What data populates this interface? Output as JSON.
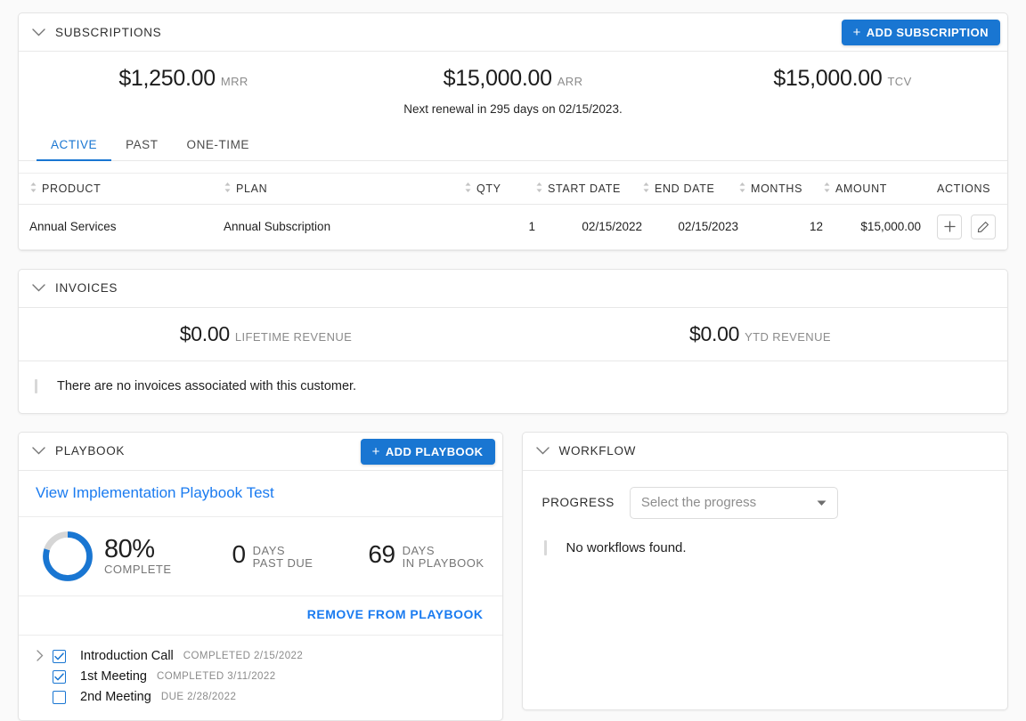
{
  "subscriptions": {
    "title": "SUBSCRIPTIONS",
    "add_button": "ADD SUBSCRIPTION",
    "add_button_plus": "+",
    "metrics": [
      {
        "value": "$1,250.00",
        "label": "MRR"
      },
      {
        "value": "$15,000.00",
        "label": "ARR"
      },
      {
        "value": "$15,000.00",
        "label": "TCV"
      }
    ],
    "renewal_note": "Next renewal in 295 days on 02/15/2023.",
    "tabs": [
      {
        "label": "ACTIVE",
        "active": true
      },
      {
        "label": "PAST",
        "active": false
      },
      {
        "label": "ONE-TIME",
        "active": false
      }
    ],
    "columns": [
      "PRODUCT",
      "PLAN",
      "QTY",
      "START DATE",
      "END DATE",
      "MONTHS",
      "AMOUNT",
      "ACTIONS"
    ],
    "rows": [
      {
        "product": "Annual Services",
        "plan": "Annual Subscription",
        "qty": "1",
        "start_date": "02/15/2022",
        "end_date": "02/15/2023",
        "months": "12",
        "amount": "$15,000.00"
      }
    ]
  },
  "invoices": {
    "title": "INVOICES",
    "metrics": [
      {
        "value": "$0.00",
        "label": "LIFETIME REVENUE"
      },
      {
        "value": "$0.00",
        "label": "YTD REVENUE"
      }
    ],
    "empty_message": "There are no invoices associated with this customer."
  },
  "playbook": {
    "title": "PLAYBOOK",
    "add_button": "ADD PLAYBOOK",
    "add_button_plus": "+",
    "link": "View Implementation Playbook Test",
    "progress": {
      "percent_value": "80%",
      "percent_label": "COMPLETE",
      "percent_number": 80
    },
    "stats": [
      {
        "number": "0",
        "line1": "DAYS",
        "line2": "PAST DUE"
      },
      {
        "number": "69",
        "line1": "DAYS",
        "line2": "IN PLAYBOOK"
      }
    ],
    "remove_button": "REMOVE FROM PLAYBOOK",
    "tasks": [
      {
        "name": "Introduction Call",
        "meta": "COMPLETED 2/15/2022",
        "checked": true,
        "expandable": true
      },
      {
        "name": "1st Meeting",
        "meta": "COMPLETED 3/11/2022",
        "checked": true,
        "expandable": false
      },
      {
        "name": "2nd Meeting",
        "meta": "DUE 2/28/2022",
        "checked": false,
        "expandable": false
      }
    ]
  },
  "workflow": {
    "title": "WORKFLOW",
    "progress_label": "PROGRESS",
    "progress_placeholder": "Select the progress",
    "empty_message": "No workflows found."
  },
  "theme": {
    "accent": "#1976d2",
    "link": "#1a7bf0",
    "muted": "#8b8b8b"
  }
}
